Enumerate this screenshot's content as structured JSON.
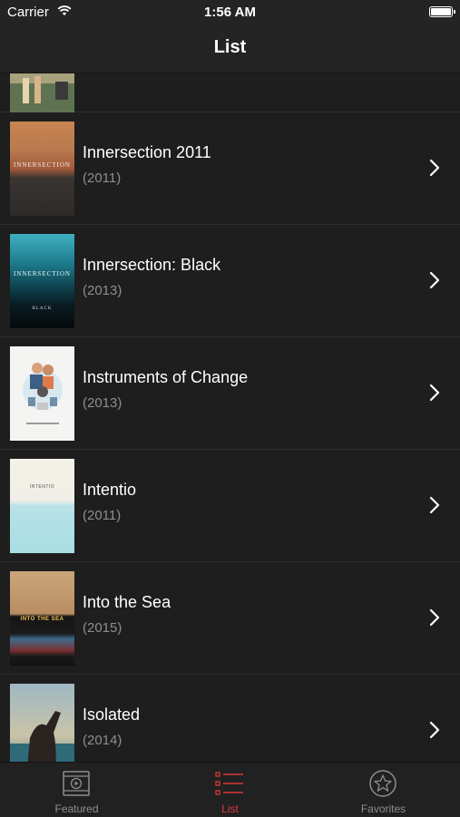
{
  "status": {
    "carrier": "Carrier",
    "time": "1:56 AM"
  },
  "nav": {
    "title": "List"
  },
  "items": [
    {
      "title": "Innersection 2011",
      "year": "(2011)",
      "poster_text": "INNERSECTION"
    },
    {
      "title": "Innersection: Black",
      "year": "(2013)",
      "poster_text": "INNERSECTION",
      "poster_subtext": "BLACK"
    },
    {
      "title": "Instruments of Change",
      "year": "(2013)"
    },
    {
      "title": "Intentio",
      "year": "(2011)",
      "poster_text": "INTENTIO"
    },
    {
      "title": "Into the Sea",
      "year": "(2015)",
      "poster_text": "INTO THE SEA"
    },
    {
      "title": "Isolated",
      "year": "(2014)"
    }
  ],
  "tabs": [
    {
      "label": "Featured",
      "icon": "film-play-icon"
    },
    {
      "label": "List",
      "icon": "list-icon"
    },
    {
      "label": "Favorites",
      "icon": "star-icon"
    }
  ],
  "colors": {
    "accent": "#d9383a",
    "background": "#1e1e1e",
    "bar": "#242424",
    "secondary_text": "#8e8e8e"
  }
}
